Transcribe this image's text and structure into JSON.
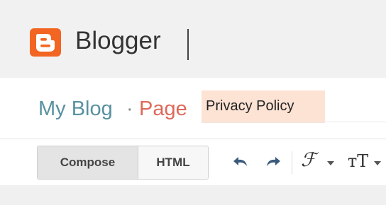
{
  "header": {
    "brand_name": "Blogger",
    "logo_icon": "blogger-logo-icon",
    "logo_color": "#f26522"
  },
  "title_bar": {
    "blog_name": "My Blog",
    "separator": "·",
    "post_type": "Page",
    "title_value": "Privacy Policy",
    "blog_name_color": "#5891a0",
    "post_type_color": "#e0685a"
  },
  "toolbar": {
    "compose_label": "Compose",
    "html_label": "HTML",
    "icons": [
      "undo-icon",
      "redo-icon",
      "font-icon",
      "font-size-icon"
    ]
  }
}
